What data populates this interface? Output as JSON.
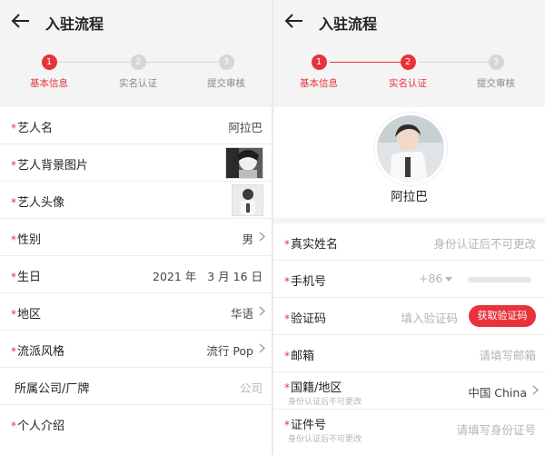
{
  "title": "入驻流程",
  "steps": [
    "基本信息",
    "实名认证",
    "提交审核"
  ],
  "step_numbers": [
    "1",
    "2",
    "3"
  ],
  "left": {
    "rows": {
      "name": {
        "label": "艺人名",
        "value": "阿拉巴"
      },
      "bg": {
        "label": "艺人背景图片"
      },
      "avatar": {
        "label": "艺人头像"
      },
      "gender": {
        "label": "性别",
        "value": "男"
      },
      "birthday": {
        "label": "生日",
        "value": "2021 年   3 月 16 日"
      },
      "region": {
        "label": "地区",
        "value": "华语"
      },
      "style": {
        "label": "流派风格",
        "value": "流行 Pop"
      },
      "company": {
        "label": "所属公司/厂牌",
        "value": "公司"
      },
      "intro": {
        "label": "个人介绍"
      }
    }
  },
  "right": {
    "avatar_name": "阿拉巴",
    "rows": {
      "realname": {
        "label": "真实姓名",
        "placeholder": "身份认证后不可更改"
      },
      "phone": {
        "label": "手机号",
        "prefix": "+86"
      },
      "code": {
        "label": "验证码",
        "placeholder": "填入验证码",
        "button": "获取验证码"
      },
      "email": {
        "label": "邮箱",
        "placeholder": "请填写邮箱"
      },
      "nationality": {
        "label": "国籍/地区",
        "sub": "身份认证后不可更改",
        "value": "中国 China"
      },
      "idnum": {
        "label": "证件号",
        "sub": "身份认证后不可更改",
        "placeholder": "请填写身份证号"
      }
    }
  },
  "colors": {
    "accent": "#e8323c",
    "inactive": "#d6d6d6",
    "header_bg": "#f4f4f4"
  }
}
